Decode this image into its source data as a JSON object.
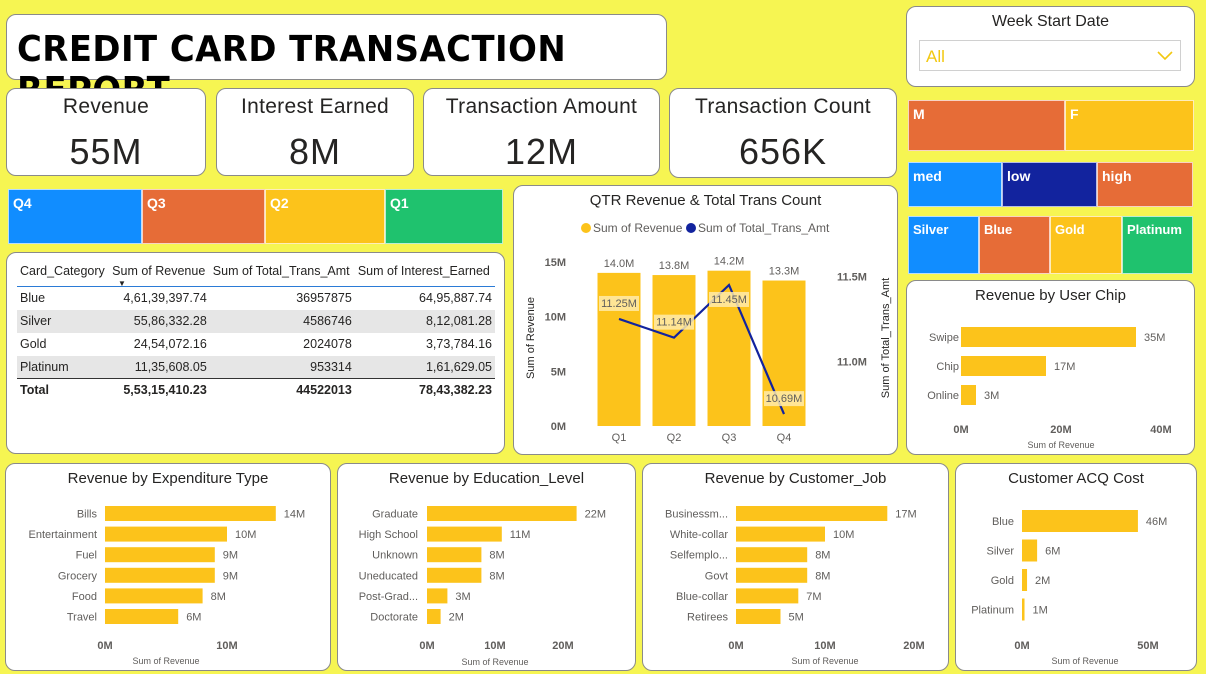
{
  "header": {
    "title": "CREDIT CARD TRANSACTION REPORT"
  },
  "slicer": {
    "label": "Week Start Date",
    "value": "All",
    "icon": "chevron-down-icon"
  },
  "kpis": [
    {
      "label": "Revenue",
      "value": "55M"
    },
    {
      "label": "Interest Earned",
      "value": "8M"
    },
    {
      "label": "Transaction Amount",
      "value": "12M"
    },
    {
      "label": "Transaction Count",
      "value": "656K"
    }
  ],
  "colors": {
    "background": "#f6f552",
    "bar": "#fcc31b",
    "line": "#12239e",
    "blue": "#118dff",
    "orange": "#e66c37",
    "yellow": "#fcc31b",
    "green": "#1fc26e",
    "navy": "#12239e"
  },
  "quarter_tiles": [
    {
      "label": "Q4",
      "color": "#118dff"
    },
    {
      "label": "Q3",
      "color": "#e66c37"
    },
    {
      "label": "Q2",
      "color": "#fcc31b"
    },
    {
      "label": "Q1",
      "color": "#1fc26e"
    }
  ],
  "gender_tiles": [
    {
      "label": "M",
      "color": "#e66c37"
    },
    {
      "label": "F",
      "color": "#fcc31b"
    }
  ],
  "income_tiles": [
    {
      "label": "med",
      "color": "#118dff"
    },
    {
      "label": "low",
      "color": "#12239e"
    },
    {
      "label": "high",
      "color": "#e66c37"
    }
  ],
  "card_tiles": [
    {
      "label": "Silver",
      "color": "#118dff"
    },
    {
      "label": "Blue",
      "color": "#e66c37"
    },
    {
      "label": "Gold",
      "color": "#fcc31b"
    },
    {
      "label": "Platinum",
      "color": "#1fc26e"
    }
  ],
  "table": {
    "columns": [
      "Card_Category",
      "Sum of Revenue",
      "Sum of Total_Trans_Amt",
      "Sum of Interest_Earned"
    ],
    "rows": [
      [
        "Blue",
        "4,61,39,397.74",
        "36957875",
        "64,95,887.74"
      ],
      [
        "Silver",
        "55,86,332.28",
        "4586746",
        "8,12,081.28"
      ],
      [
        "Gold",
        "24,54,072.16",
        "2024078",
        "3,73,784.16"
      ],
      [
        "Platinum",
        "11,35,608.05",
        "953314",
        "1,61,629.05"
      ]
    ],
    "total": [
      "Total",
      "5,53,15,410.23",
      "44522013",
      "78,43,382.23"
    ]
  },
  "chart_data": [
    {
      "type": "bar+line",
      "title": "QTR Revenue & Total Trans Count",
      "legend": [
        "Sum of Revenue",
        "Sum of Total_Trans_Amt"
      ],
      "legend_position": "top",
      "categories": [
        "Q1",
        "Q2",
        "Q3",
        "Q4"
      ],
      "series": [
        {
          "name": "Sum of Revenue",
          "values": [
            14.0,
            13.8,
            14.2,
            13.3
          ],
          "labels": [
            "14.0M",
            "13.8M",
            "14.2M",
            "13.3M"
          ]
        },
        {
          "name": "Sum of Total_Trans_Amt",
          "values": [
            11.25,
            11.14,
            11.45,
            10.69
          ],
          "labels": [
            "11.25M",
            "11.14M",
            "11.45M",
            "10.69M"
          ]
        }
      ],
      "ylabel": "Sum of Revenue",
      "y2label": "Sum of Total_Trans_Amt",
      "yticks": [
        "0M",
        "5M",
        "10M",
        "15M"
      ],
      "ylim": [
        0,
        16
      ],
      "y2ticks": [
        "11.0M",
        "11.5M"
      ],
      "y2lim": [
        10.62,
        11.65
      ]
    },
    {
      "type": "bar",
      "title": "Revenue by User Chip",
      "categories": [
        "Swipe",
        "Chip",
        "Online"
      ],
      "values": [
        35,
        17,
        3
      ],
      "labels": [
        "35M",
        "17M",
        "3M"
      ],
      "xticks": [
        "0M",
        "20M",
        "40M"
      ],
      "xlim": [
        0,
        40
      ],
      "xlabel": "Sum of Revenue"
    },
    {
      "type": "bar",
      "title": "Revenue by Expenditure Type",
      "categories": [
        "Bills",
        "Entertainment",
        "Fuel",
        "Grocery",
        "Food",
        "Travel"
      ],
      "values": [
        14,
        10,
        9,
        9,
        8,
        6
      ],
      "labels": [
        "14M",
        "10M",
        "9M",
        "9M",
        "8M",
        "6M"
      ],
      "xticks": [
        "0M",
        "10M"
      ],
      "xlim": [
        0,
        10
      ],
      "xlabel": "Sum of Revenue"
    },
    {
      "type": "bar",
      "title": "Revenue by Education_Level",
      "categories": [
        "Graduate",
        "High School",
        "Unknown",
        "Uneducated",
        "Post-Grad...",
        "Doctorate"
      ],
      "values": [
        22,
        11,
        8,
        8,
        3,
        2
      ],
      "labels": [
        "22M",
        "11M",
        "8M",
        "8M",
        "3M",
        "2M"
      ],
      "xticks": [
        "0M",
        "10M",
        "20M"
      ],
      "xlim": [
        0,
        20
      ],
      "xlabel": "Sum of Revenue"
    },
    {
      "type": "bar",
      "title": "Revenue by Customer_Job",
      "categories": [
        "Businessm...",
        "White-collar",
        "Selfemplo...",
        "Govt",
        "Blue-collar",
        "Retirees"
      ],
      "values": [
        17,
        10,
        8,
        8,
        7,
        5
      ],
      "labels": [
        "17M",
        "10M",
        "8M",
        "8M",
        "7M",
        "5M"
      ],
      "xticks": [
        "0M",
        "10M",
        "20M"
      ],
      "xlim": [
        0,
        20
      ],
      "xlabel": "Sum of Revenue"
    },
    {
      "type": "bar",
      "title": "Customer ACQ Cost",
      "categories": [
        "Blue",
        "Silver",
        "Gold",
        "Platinum"
      ],
      "values": [
        46,
        6,
        2,
        1
      ],
      "labels": [
        "46M",
        "6M",
        "2M",
        "1M"
      ],
      "xticks": [
        "0M",
        "50M"
      ],
      "xlim": [
        0,
        50
      ],
      "xlabel": "Sum of Revenue"
    }
  ]
}
